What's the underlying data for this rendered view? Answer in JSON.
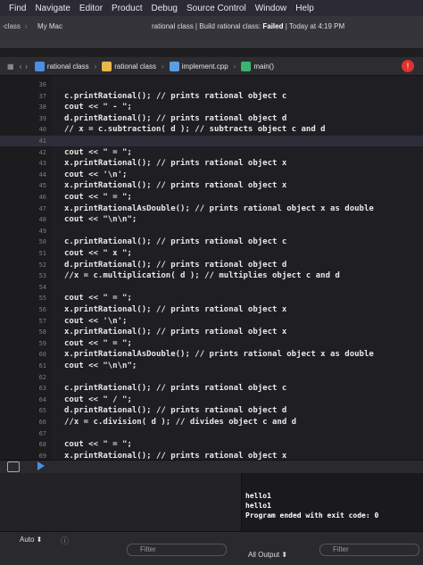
{
  "menu": [
    "Find",
    "Navigate",
    "Editor",
    "Product",
    "Debug",
    "Source Control",
    "Window",
    "Help"
  ],
  "toolbar": {
    "scheme": "·class",
    "destination": "My Mac",
    "status_prefix": "rational class | Build rational class: ",
    "status_result": "Failed",
    "status_suffix": " | Today at 4:19 PM"
  },
  "jumpbar": {
    "crumbs": [
      "rational class",
      "rational class",
      "implement.cpp",
      "main()"
    ],
    "error_count": "!"
  },
  "code": [
    {
      "n": "36",
      "t": ""
    },
    {
      "n": "37",
      "t": "c.printRational(); // prints rational object c"
    },
    {
      "n": "38",
      "t": "cout << \" - \";"
    },
    {
      "n": "39",
      "t": "d.printRational(); // prints rational object d"
    },
    {
      "n": "40",
      "t": "// x = c.subtraction( d ); // subtracts object c and d"
    },
    {
      "n": "41",
      "t": ""
    },
    {
      "n": "42",
      "t": "cout << \" = \";"
    },
    {
      "n": "43",
      "t": "x.printRational(); // prints rational object x"
    },
    {
      "n": "44",
      "t": "cout << '\\n';"
    },
    {
      "n": "45",
      "t": "x.printRational(); // prints rational object x"
    },
    {
      "n": "46",
      "t": "cout << \" = \";"
    },
    {
      "n": "47",
      "t": "x.printRationalAsDouble(); // prints rational object x as double"
    },
    {
      "n": "48",
      "t": "cout << \"\\n\\n\";"
    },
    {
      "n": "49",
      "t": ""
    },
    {
      "n": "50",
      "t": "c.printRational(); // prints rational object c"
    },
    {
      "n": "51",
      "t": "cout << \" x \";"
    },
    {
      "n": "52",
      "t": "d.printRational(); // prints rational object d"
    },
    {
      "n": "53",
      "t": "//x = c.multiplication( d ); // multiplies object c and d"
    },
    {
      "n": "54",
      "t": ""
    },
    {
      "n": "55",
      "t": "cout << \" = \";"
    },
    {
      "n": "56",
      "t": "x.printRational(); // prints rational object x"
    },
    {
      "n": "57",
      "t": "cout << '\\n';"
    },
    {
      "n": "58",
      "t": "x.printRational(); // prints rational object x"
    },
    {
      "n": "59",
      "t": "cout << \" = \";"
    },
    {
      "n": "60",
      "t": "x.printRationalAsDouble(); // prints rational object x as double"
    },
    {
      "n": "61",
      "t": "cout << \"\\n\\n\";"
    },
    {
      "n": "62",
      "t": ""
    },
    {
      "n": "63",
      "t": "c.printRational(); // prints rational object c"
    },
    {
      "n": "64",
      "t": "cout << \" / \";"
    },
    {
      "n": "65",
      "t": "d.printRational(); // prints rational object d"
    },
    {
      "n": "66",
      "t": "//x = c.division( d ); // divides object c and d"
    },
    {
      "n": "67",
      "t": ""
    },
    {
      "n": "68",
      "t": "cout << \" = \";"
    },
    {
      "n": "69",
      "t": "x.printRational(); // prints rational object x"
    },
    {
      "n": "70",
      "t": "cout << '\\n';"
    }
  ],
  "console_lines": [
    "hello1",
    "hello1",
    "Program ended with exit code: 0"
  ],
  "bottom": {
    "auto": "Auto ⬍",
    "filter_left": "Filter",
    "all_output": "All Output ⬍",
    "filter_right": "Filter"
  },
  "colors": {
    "error": "#e0322d",
    "accent": "#4a8fe6",
    "folder": "#e8b84a",
    "cpp": "#5aa0e0",
    "func": "#3cb371"
  }
}
